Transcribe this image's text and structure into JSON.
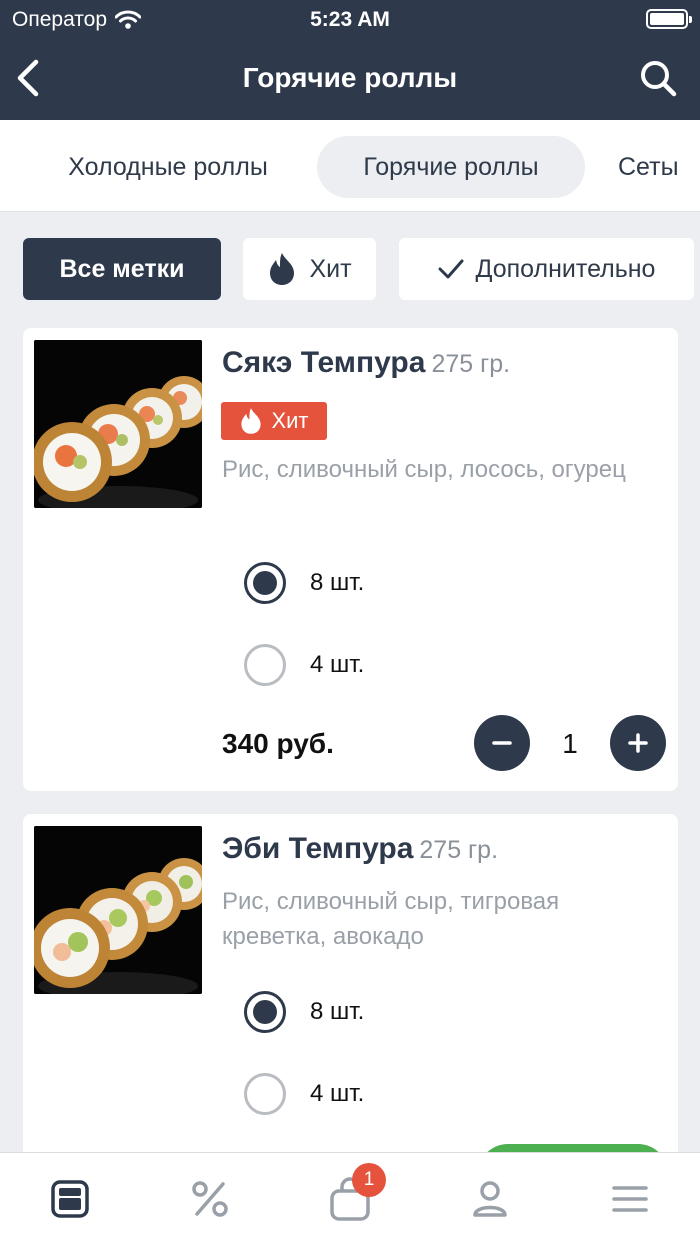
{
  "status_bar": {
    "carrier": "Оператор",
    "time": "5:23 AM"
  },
  "header": {
    "title": "Горячие роллы"
  },
  "categories": [
    {
      "label": "Холодные роллы",
      "active": false
    },
    {
      "label": "Горячие роллы",
      "active": true
    },
    {
      "label": "Сеты",
      "active": false
    }
  ],
  "filters": {
    "all_tags": "Все метки",
    "hit": "Хит",
    "more": "Дополнительно"
  },
  "products": [
    {
      "name": "Сякэ Темпура",
      "weight": "275 гр.",
      "badge": "Хит",
      "description": "Рис, сливочный сыр, лосось, огурец",
      "options": [
        {
          "label": "8 шт.",
          "selected": true
        },
        {
          "label": "4 шт.",
          "selected": false
        }
      ],
      "price": "340 руб.",
      "quantity": "1"
    },
    {
      "name": "Эби Темпура",
      "weight": "275 гр.",
      "description": "Рис, сливочный сыр, тигровая креветка, авокадо",
      "options": [
        {
          "label": "8 шт.",
          "selected": true
        },
        {
          "label": "4 шт.",
          "selected": false
        }
      ]
    }
  ],
  "tabbar": {
    "cart_count": "1",
    "tabs": [
      "menu-icon",
      "percent-icon",
      "cart-icon",
      "profile-icon",
      "hamburger-icon"
    ]
  },
  "colors": {
    "primary": "#2e3a4b",
    "accent_red": "#e5533d",
    "green": "#4caf50",
    "background": "#eceef1"
  }
}
